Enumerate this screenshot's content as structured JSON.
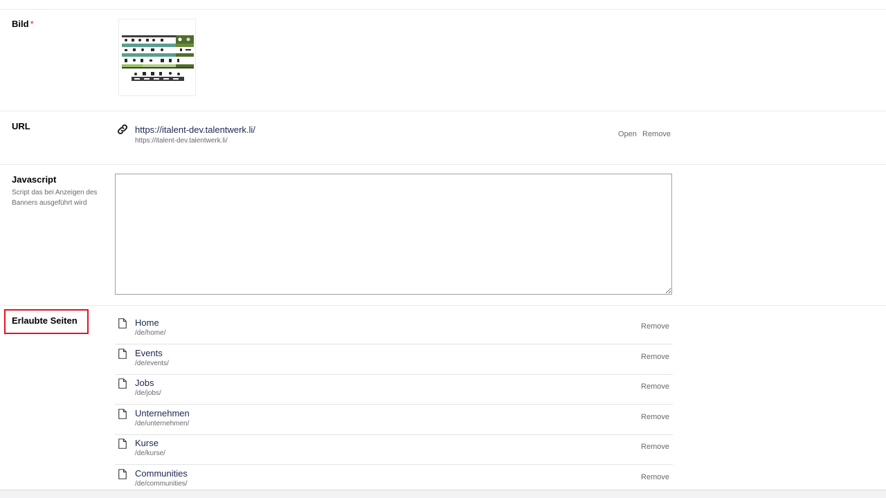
{
  "fields": {
    "bild": {
      "label": "Bild",
      "required_mark": "*"
    },
    "url": {
      "label": "URL",
      "link_title": "https://italent-dev.talentwerk.li/",
      "link_url": "https://italent-dev.talentwerk.li/",
      "open_label": "Open",
      "remove_label": "Remove"
    },
    "javascript": {
      "label": "Javascript",
      "description": "Script das bei Anzeigen des Banners ausgeführt wird",
      "value": ""
    },
    "erlaubte_seiten": {
      "label": "Erlaubte Seiten",
      "pages": [
        {
          "name": "Home",
          "path": "/de/home/",
          "remove_label": "Remove"
        },
        {
          "name": "Events",
          "path": "/de/events/",
          "remove_label": "Remove"
        },
        {
          "name": "Jobs",
          "path": "/de/jobs/",
          "remove_label": "Remove"
        },
        {
          "name": "Unternehmen",
          "path": "/de/unternehmen/",
          "remove_label": "Remove"
        },
        {
          "name": "Kurse",
          "path": "/de/kurse/",
          "remove_label": "Remove"
        },
        {
          "name": "Communities",
          "path": "/de/communities/",
          "remove_label": "Remove"
        }
      ]
    }
  },
  "icons": {
    "url_link": "link-icon",
    "page_item": "document-icon"
  },
  "colors": {
    "highlight_border": "#e6101f",
    "required_mark": "#d42054",
    "text_primary": "#1b264f",
    "text_secondary": "#68676b"
  }
}
